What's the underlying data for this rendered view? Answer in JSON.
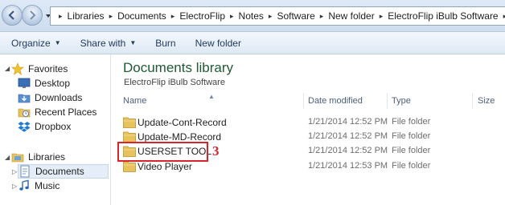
{
  "address_bar": {
    "crumbs": [
      "Libraries",
      "Documents",
      "ElectroFlip",
      "Notes",
      "Software",
      "New folder",
      "ElectroFlip iBulb Software"
    ]
  },
  "command_bar": {
    "organize": "Organize",
    "share_with": "Share with",
    "burn": "Burn",
    "new_folder": "New folder"
  },
  "nav_pane": {
    "favorites_label": "Favorites",
    "favorites": [
      "Desktop",
      "Downloads",
      "Recent Places",
      "Dropbox"
    ],
    "libraries_label": "Libraries",
    "libraries": [
      "Documents",
      "Music"
    ]
  },
  "library": {
    "title": "Documents library",
    "subtitle": "ElectroFlip iBulb Software"
  },
  "columns": [
    "Name",
    "Date modified",
    "Type",
    "Size"
  ],
  "files": [
    {
      "name": "Update-Cont-Record",
      "date": "1/21/2014 12:52 PM",
      "type": "File folder"
    },
    {
      "name": "Update-MD-Record",
      "date": "1/21/2014 12:52 PM",
      "type": "File folder"
    },
    {
      "name": "USERSET TOOL",
      "date": "1/21/2014 12:52 PM",
      "type": "File folder"
    },
    {
      "name": "Video Player",
      "date": "1/21/2014 12:53 PM",
      "type": "File folder"
    }
  ],
  "annotation": {
    "number": "3",
    "color": "#d8242b"
  },
  "colors": {
    "library_title": "#1e5a32",
    "command_text": "#1e395b",
    "selection": "#e5eef8"
  }
}
